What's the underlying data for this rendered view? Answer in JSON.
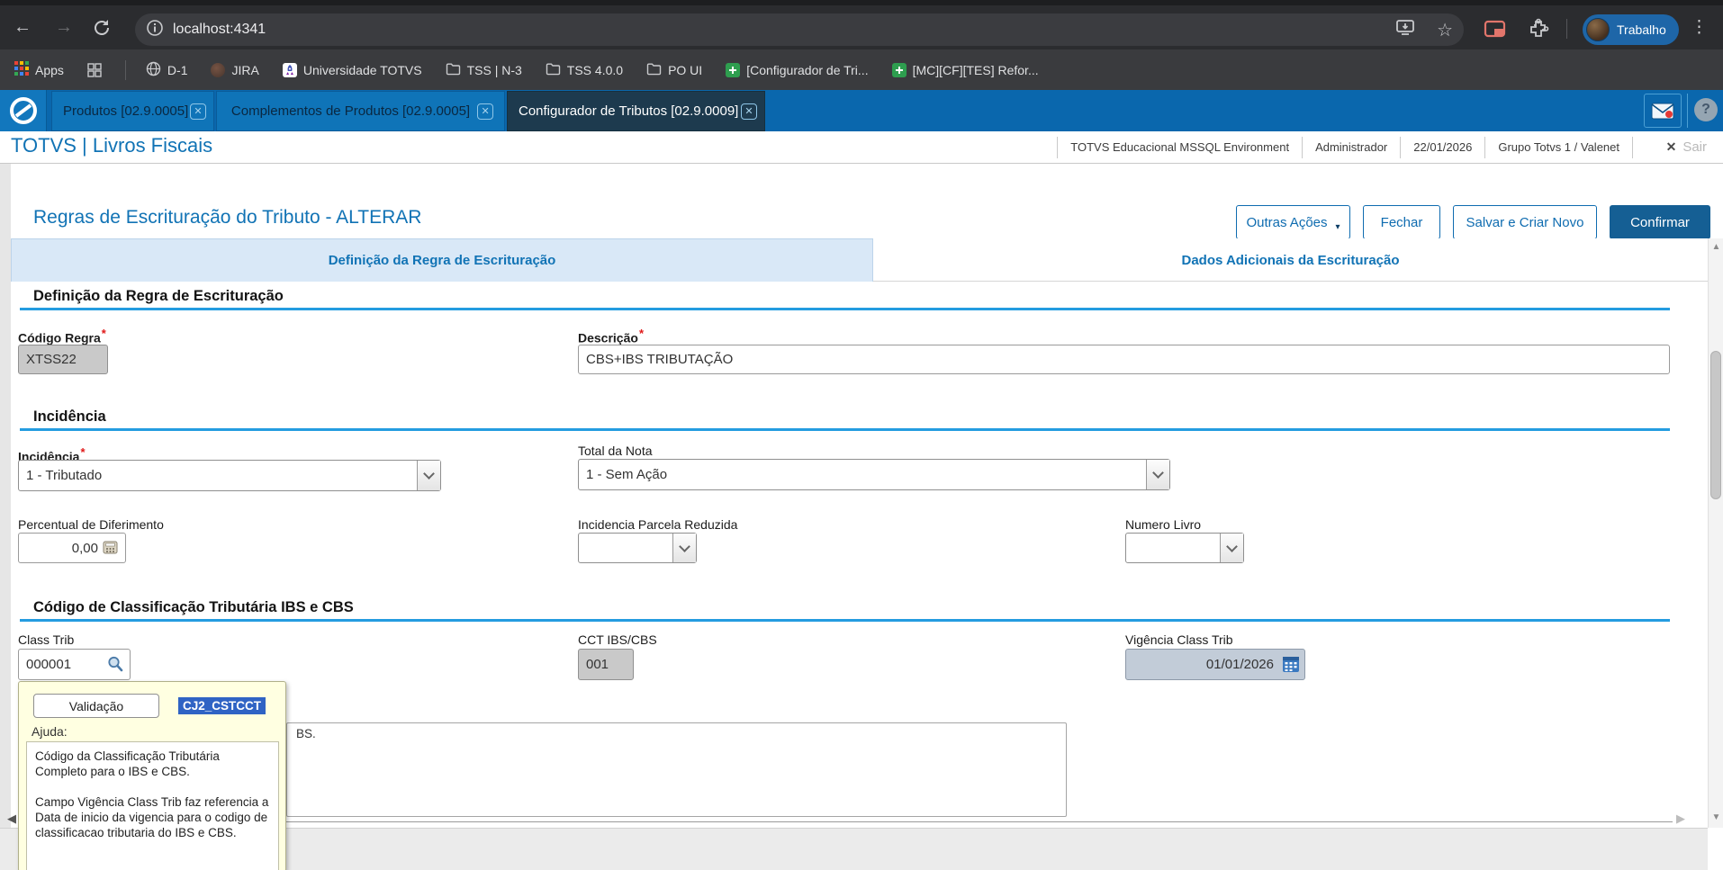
{
  "glyphs": {
    "back": "←",
    "forward": "→",
    "dots": "⋮",
    "star": "☆",
    "close": "✕",
    "caret": "▾",
    "question": "?",
    "left": "◀",
    "right": "▶",
    "up": "▲",
    "down": "▼"
  },
  "browser": {
    "url": "localhost:4341",
    "profile_label": "Trabalho",
    "bookmarks": {
      "apps_label": "Apps",
      "items": [
        {
          "label": "D-1",
          "icon": "globe-icon"
        },
        {
          "label": "JIRA",
          "icon": "jira-icon"
        },
        {
          "label": "Universidade TOTVS",
          "icon": "university-icon"
        },
        {
          "label": "TSS | N-3",
          "icon": "folder-icon"
        },
        {
          "label": "TSS 4.0.0",
          "icon": "folder-icon"
        },
        {
          "label": "PO UI",
          "icon": "folder-icon"
        },
        {
          "label": "[Configurador de Tri...",
          "icon": "sheet-icon"
        },
        {
          "label": "[MC][CF][TES] Refor...",
          "icon": "sheet-icon"
        }
      ]
    }
  },
  "workspace": {
    "tabs": [
      {
        "label": "Produtos [02.9.0005]",
        "active": false
      },
      {
        "label": "Complementos de Produtos [02.9.0005]",
        "active": false
      },
      {
        "label": "Configurador de Tributos [02.9.0009]",
        "active": true
      }
    ]
  },
  "app_header": {
    "brand": "TOTVS | Livros Fiscais",
    "environment": "TOTVS Educacional MSSQL Environment",
    "user": "Administrador",
    "date": "22/01/2026",
    "group": "Grupo Totvs 1 / Valenet",
    "logout": "Sair"
  },
  "page": {
    "title": "Regras de Escrituração do Tributo - ALTERAR",
    "actions": {
      "others": "Outras Ações",
      "close": "Fechar",
      "save_new": "Salvar e Criar Novo",
      "confirm": "Confirmar"
    }
  },
  "form_tabs": {
    "tab1": "Definição da Regra de Escrituração",
    "tab2": "Dados Adicionais da Escrituração"
  },
  "ui": {
    "required_mark": "*"
  },
  "sections": {
    "definicao": {
      "title": "Definição da Regra de Escrituração",
      "codigo_regra": {
        "label": "Código Regra",
        "value": "XTSS22"
      },
      "descricao": {
        "label": "Descrição",
        "value": "CBS+IBS TRIBUTAÇÃO"
      }
    },
    "incidencia": {
      "title": "Incidência",
      "incidencia": {
        "label": "Incidência",
        "value": "1 - Tributado"
      },
      "total_nota": {
        "label": "Total da Nota",
        "value": "1 - Sem Ação"
      },
      "percentual": {
        "label": "Percentual de Diferimento",
        "value": "0,00"
      },
      "parcela_reduzida": {
        "label": "Incidencia Parcela Reduzida",
        "value": ""
      },
      "numero_livro": {
        "label": "Numero Livro",
        "value": ""
      }
    },
    "classificacao": {
      "title": "Código de Classificação Tributária IBS e CBS",
      "class_trib": {
        "label": "Class Trib",
        "value": "000001"
      },
      "cct": {
        "label": "CCT IBS/CBS",
        "value": "001"
      },
      "vigencia": {
        "label": "Vigência Class Trib",
        "value": "01/01/2026"
      },
      "notes_visible_fragment": "BS."
    }
  },
  "tooltip": {
    "validate_button": "Validação",
    "field_code": "CJ2_CSTCCT",
    "help_label": "Ajuda:",
    "help_text_1": "Código da Classificação Tributária Completo para o IBS e CBS.",
    "help_text_2": "Campo Vigência Class Trib faz referencia a Data de inicio da vigencia para o codigo de classificacao tributaria do IBS e CBS."
  },
  "colors": {
    "accent_blue": "#1173b5",
    "workspace_bar_blue": "#0a67ad",
    "active_tab_dark": "#1d3a4e",
    "section_rule_blue": "#249ce0",
    "selection_blue": "#2f63c4",
    "tooltip_bg": "#ffffe1",
    "primary_button": "#155f94",
    "required_red": "#e01818"
  }
}
